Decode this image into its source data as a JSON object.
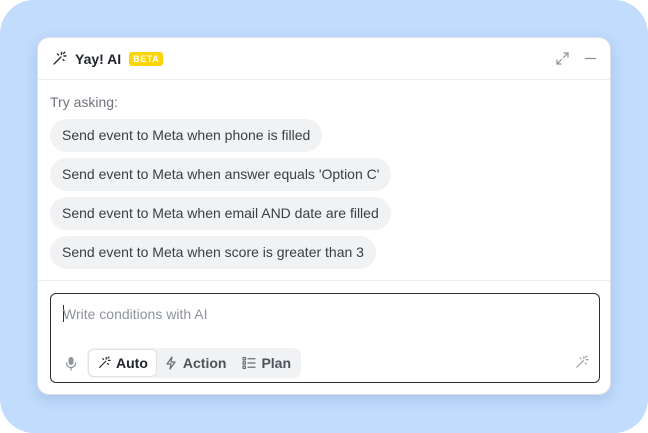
{
  "header": {
    "title": "Yay! AI",
    "badge": "BETA",
    "icon": "magic-wand-icon",
    "controls": [
      "expand-icon",
      "minimize-icon"
    ]
  },
  "prompts": {
    "label": "Try asking:",
    "suggestions": [
      "Send event to Meta when phone is filled",
      "Send event to Meta when answer equals 'Option C'",
      "Send event to Meta when email AND date are filled",
      "Send event to Meta when score is greater than 3"
    ]
  },
  "composer": {
    "placeholder": "Write conditions with AI",
    "value": "",
    "modes": [
      {
        "label": "Auto",
        "icon": "magic-wand-icon",
        "active": true
      },
      {
        "label": "Action",
        "icon": "lightning-icon",
        "active": false
      },
      {
        "label": "Plan",
        "icon": "checklist-icon",
        "active": false
      }
    ]
  },
  "colors": {
    "backdrop": "#c1dcfd",
    "badge": "#fcd40a",
    "chip": "#f1f2f4",
    "text": "#22252b"
  }
}
